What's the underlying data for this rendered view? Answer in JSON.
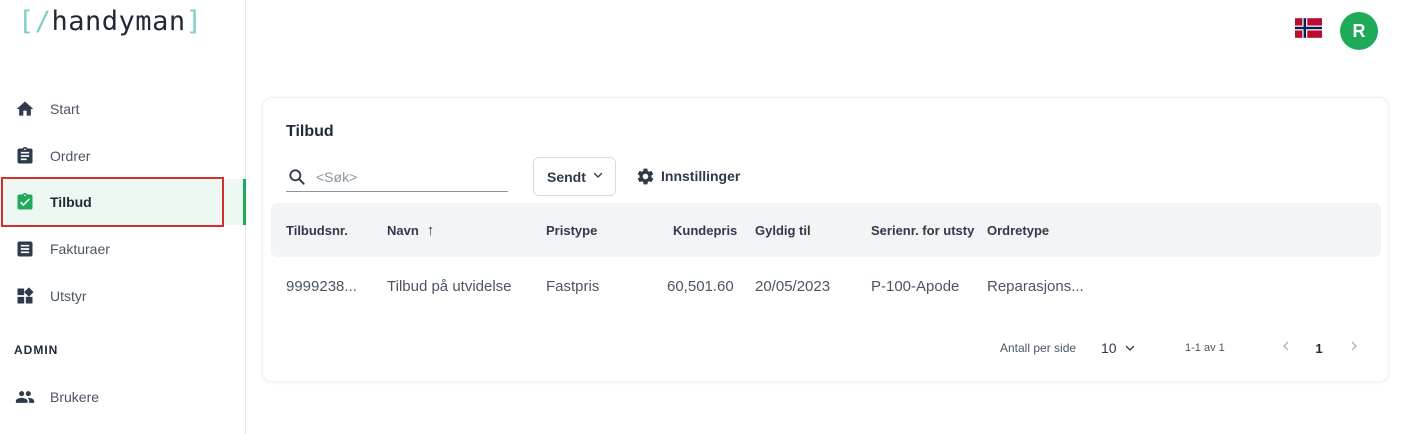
{
  "logo": {
    "open_bracket": "[",
    "slash": "/",
    "name": "handyman",
    "close_bracket": "]"
  },
  "sidebar": {
    "items": [
      {
        "label": "Start",
        "icon": "home-icon"
      },
      {
        "label": "Ordrer",
        "icon": "clipboard-icon"
      },
      {
        "label": "Tilbud",
        "icon": "clipboard-check-icon",
        "active": true
      },
      {
        "label": "Fakturaer",
        "icon": "invoice-icon"
      },
      {
        "label": "Utstyr",
        "icon": "widgets-icon"
      }
    ],
    "admin_title": "ADMIN",
    "admin_items": [
      {
        "label": "Brukere",
        "icon": "users-icon"
      }
    ]
  },
  "header": {
    "avatar_initial": "R",
    "flag": "norway-flag-icon"
  },
  "card": {
    "title": "Tilbud",
    "search_placeholder": "<Søk>",
    "status_filter": "Sendt",
    "settings_label": "Innstillinger"
  },
  "table": {
    "columns": [
      "Tilbudsnr.",
      "Navn",
      "Pristype",
      "Kundepris",
      "Gyldig til",
      "Serienr. for utsty",
      "Ordretype"
    ],
    "sort_indicator": "↑",
    "rows": [
      [
        "9999238...",
        "Tilbud på utvidelse",
        "Fastpris",
        "60,501.60",
        "20/05/2023",
        "P-100-Apode",
        "Reparasjons..."
      ]
    ]
  },
  "pagination": {
    "per_page_label": "Antall per side",
    "per_page_value": "10",
    "range": "1-1 av 1",
    "current_page": "1"
  },
  "colors": {
    "accent": "#1faa5a",
    "logo_bracket": "#7fd0c6",
    "highlight": "#d32f2f"
  }
}
